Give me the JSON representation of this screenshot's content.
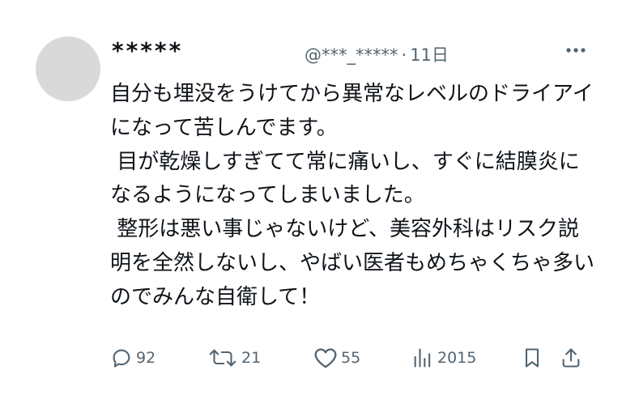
{
  "post": {
    "display_name": "*****",
    "handle": "@***_*****",
    "separator": "·",
    "time_ago": "11日",
    "body": "自分も埋没をうけてから異常なレベルのドライアイになって苦しんでます。\n 目が乾燥しすぎてて常に痛いし、すぐに結膜炎になるようになってしまいました。\n 整形は悪い事じゃないけど、美容外科はリスク説明を全然しないし、やばい医者もめちゃくちゃ多いのでみんな自衛して！"
  },
  "actions": {
    "replies": "92",
    "reposts": "21",
    "likes": "55",
    "views": "2015"
  },
  "colors": {
    "text": "#0f1419",
    "secondary": "#536471",
    "avatar_placeholder": "#d9d9d9"
  },
  "icons": [
    "more-icon",
    "reply-icon",
    "repost-icon",
    "like-icon",
    "views-icon",
    "bookmark-icon",
    "share-icon"
  ]
}
